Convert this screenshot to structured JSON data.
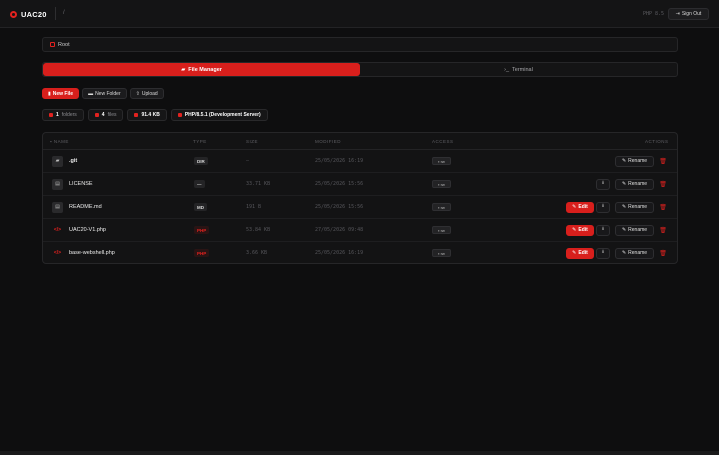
{
  "header": {
    "brand": "UAC20",
    "path": "/",
    "version": "PHP 8.5",
    "sign_out": "Sign Out"
  },
  "breadcrumb": {
    "root": "Root"
  },
  "tabs": [
    {
      "label": "File Manager",
      "active": true,
      "icon": "folder-icon"
    },
    {
      "label": "Terminal",
      "active": false,
      "icon": "terminal-icon"
    }
  ],
  "actions": {
    "new_file": "New File",
    "new_folder": "New Folder",
    "upload": "Upload"
  },
  "stats": {
    "folders_count": "1",
    "folders_label": "folders",
    "files_count": "4",
    "files_label": "files",
    "size": "91.4 KB",
    "php": "PHP/8.5.1 (Development Server)"
  },
  "table": {
    "headers": {
      "name": "NAME",
      "type": "TYPE",
      "size": "SIZE",
      "modified": "MODIFIED",
      "access": "ACCESS",
      "actions": "ACTIONS"
    },
    "rows": [
      {
        "name": ".git",
        "type": "DIR",
        "size": "—",
        "modified": "25/05/2026 16:19",
        "access": "rw",
        "icon": "folder-icon"
      },
      {
        "name": "LICENSE",
        "type": "—",
        "size": "33.71 KB",
        "modified": "25/05/2026 15:56",
        "access": "rw",
        "icon": "file-icon"
      },
      {
        "name": "README.md",
        "type": "MD",
        "size": "191 B",
        "modified": "25/05/2026 15:56",
        "access": "rw",
        "icon": "file-icon"
      },
      {
        "name": "UAC20-V1.php",
        "type": "PHP",
        "size": "53.84 KB",
        "modified": "27/05/2026 09:48",
        "access": "rw",
        "icon": "code-icon"
      },
      {
        "name": "base-webshell.php",
        "type": "PHP",
        "size": "3.66 KB",
        "modified": "25/05/2026 16:19",
        "access": "rw",
        "icon": "code-icon"
      }
    ],
    "edit_label": "Edit",
    "rename_label": "Rename"
  },
  "colors": {
    "accent": "#d81f1c",
    "background": "#0e0e0f",
    "panel": "#141415"
  }
}
